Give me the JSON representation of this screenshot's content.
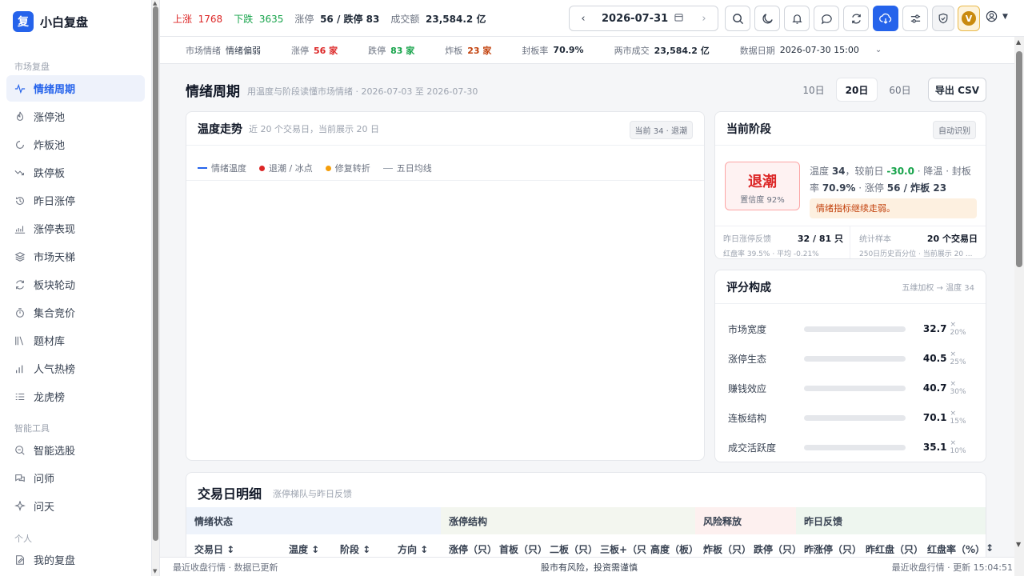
{
  "app": {
    "logo_char": "复",
    "name": "小白复盘"
  },
  "sidebar": {
    "group1": "市场复盘",
    "group2": "智能工具",
    "group3": "个人",
    "items": [
      {
        "label": "情绪周期",
        "icon": "pulse-icon"
      },
      {
        "label": "涨停池",
        "icon": "flame-icon"
      },
      {
        "label": "炸板池",
        "icon": "circle-break-icon"
      },
      {
        "label": "跌停板",
        "icon": "trend-down-icon"
      },
      {
        "label": "昨日涨停",
        "icon": "history-icon"
      },
      {
        "label": "涨停表现",
        "icon": "chart-line-icon"
      },
      {
        "label": "市场天梯",
        "icon": "layers-icon"
      },
      {
        "label": "板块轮动",
        "icon": "rotate-icon"
      },
      {
        "label": "集合竞价",
        "icon": "timer-icon"
      },
      {
        "label": "题材库",
        "icon": "library-icon"
      },
      {
        "label": "人气热榜",
        "icon": "bar-chart-icon"
      },
      {
        "label": "龙虎榜",
        "icon": "list-icon"
      },
      {
        "label": "智能选股",
        "icon": "search-scan-icon"
      },
      {
        "label": "问师",
        "icon": "chat-icon"
      },
      {
        "label": "问天",
        "icon": "sparkle-icon"
      },
      {
        "label": "我的复盘",
        "icon": "edit-icon"
      }
    ]
  },
  "topbar": {
    "up_label": "上涨",
    "up_value": "1768",
    "down_label": "下跌",
    "down_value": "3635",
    "limit_label": "涨停",
    "limit_value": "56 / 跌停 83",
    "turnover_label": "成交额",
    "turnover_value": "23,584.2 亿",
    "date": "2026-07-31",
    "avatar_letter": "V"
  },
  "subbar": {
    "mood_k": "市场情绪",
    "mood_v": "情绪偏弱",
    "zt_k": "涨停",
    "zt_v": "56 家",
    "dt_k": "跌停",
    "dt_v": "83 家",
    "zb_k": "炸板",
    "zb_v": "23 家",
    "fb_k": "封板率",
    "fb_v": "70.9%",
    "vol_k": "两市成交",
    "vol_v": "23,584.2 亿",
    "date_k": "数据日期",
    "date_v": "2026-07-30 15:00"
  },
  "page": {
    "title": "情绪周期",
    "subtitle": "用温度与阶段读懂市场情绪 · 2026-07-03 至 2026-07-30",
    "ranges": [
      "10日",
      "20日",
      "60日"
    ],
    "active_range": "20日",
    "export": "导出 CSV"
  },
  "trend": {
    "title": "温度走势",
    "subtitle": "近 20 个交易日，当前展示 20 日",
    "tag": "当前 34 · 退潮",
    "legend": [
      "情绪温度",
      "退潮 / 冰点",
      "修复转折",
      "五日均线"
    ]
  },
  "stage": {
    "title": "当前阶段",
    "tag": "自动识别",
    "name": "退潮",
    "confidence": "置信度 92%",
    "desc_prefix": "温度 ",
    "temp": "34",
    "desc_mid": "，较前日 ",
    "delta": "-30.0",
    "desc_mid2": " · 降温 · 封板率 ",
    "fb": "70.9%",
    "desc_mid3": " · 涨停 ",
    "zt": "56 / 炸板 23",
    "warning": "情绪指标继续走弱。",
    "stat1_k": "昨日涨停反馈",
    "stat1_v": "32 / 81 只",
    "stat1_s": "红盘率 39.5% · 平均 -0.21%",
    "stat2_k": "统计样本",
    "stat2_v": "20 个交易日",
    "stat2_s": "250日历史百分位 · 当前展示 20 ..."
  },
  "score": {
    "title": "评分构成",
    "tag": "五维加权 → 温度 34",
    "rows": [
      {
        "label": "市场宽度",
        "value": "32.7",
        "weight": "× 20%",
        "pct": 32.7
      },
      {
        "label": "涨停生态",
        "value": "40.5",
        "weight": "× 25%",
        "pct": 40.5
      },
      {
        "label": "赚钱效应",
        "value": "40.7",
        "weight": "× 30%",
        "pct": 40.7
      },
      {
        "label": "连板结构",
        "value": "70.1",
        "weight": "× 15%",
        "pct": 70.1
      },
      {
        "label": "成交活跃度",
        "value": "35.1",
        "weight": "× 10%",
        "pct": 35.1
      }
    ]
  },
  "table": {
    "title": "交易日明细",
    "subtitle": "涨停梯队与昨日反馈",
    "groups": [
      "情绪状态",
      "涨停结构",
      "风险释放",
      "昨日反馈"
    ],
    "columns": [
      "交易日 ↕",
      "温度 ↕",
      "阶段 ↕",
      "方向 ↕",
      "涨停（只）",
      "首板（只）",
      "二板（只）",
      "三板+（只",
      "高度（板）",
      "炸板（只）",
      "跌停（只）",
      "昨涨停（只）",
      "昨红盘（只）",
      "红盘率（%）",
      "↕"
    ]
  },
  "footer": {
    "left": "最近收盘行情 · 数据已更新",
    "center": "股市有风险，投资需谨慎",
    "right": "最近收盘行情 · 更新 15:04:51"
  }
}
